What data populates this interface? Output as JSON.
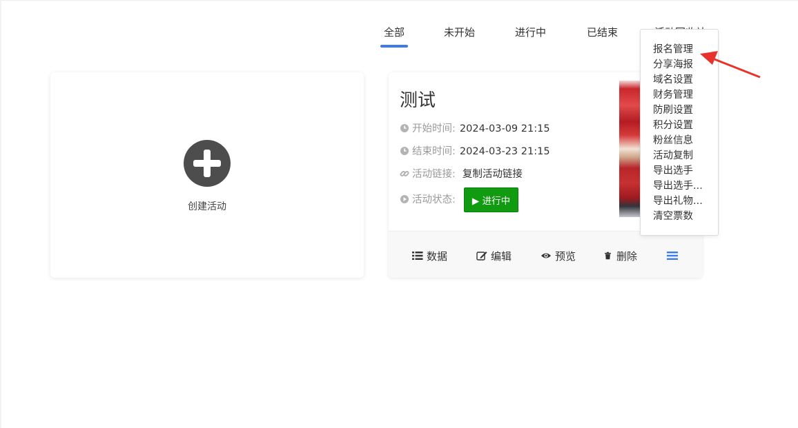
{
  "tabs": [
    {
      "label": "全部",
      "active": true
    },
    {
      "label": "未开始",
      "active": false
    },
    {
      "label": "进行中",
      "active": false
    },
    {
      "label": "已结束",
      "active": false
    },
    {
      "label": "活动回收站",
      "active": false
    }
  ],
  "create_card": {
    "label": "创建活动",
    "icon": "plus-circle-icon"
  },
  "activity": {
    "title": "测试",
    "start": {
      "label": "开始时间:",
      "value": "2024-03-09 21:15"
    },
    "end": {
      "label": "结束时间:",
      "value": "2024-03-23 21:15"
    },
    "link": {
      "label": "活动链接:",
      "value": "复制活动链接"
    },
    "status": {
      "label": "活动状态:",
      "value": "▶ 进行中",
      "color": "#109b10"
    },
    "footer": {
      "data": "数据",
      "edit": "编辑",
      "preview": "预览",
      "delete": "删除"
    }
  },
  "dropdown": {
    "items": [
      "报名管理",
      "分享海报",
      "域名设置",
      "财务管理",
      "防刷设置",
      "积分设置",
      "粉丝信息",
      "活动复制",
      "导出选手",
      "导出选手...",
      "导出礼物...",
      "清空票数"
    ]
  },
  "colors": {
    "accent": "#3d7be6",
    "status_green": "#109b10",
    "annotation_red": "#e8332c"
  }
}
